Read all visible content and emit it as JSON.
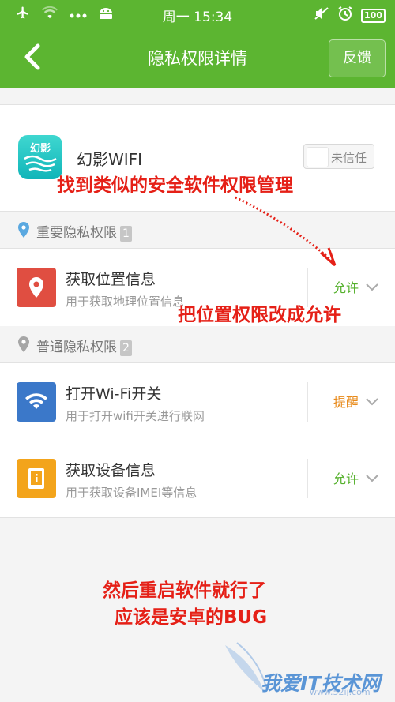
{
  "statusbar": {
    "time": "周一 15:34",
    "battery": "100"
  },
  "nav": {
    "title": "隐私权限详情",
    "feedback": "反馈"
  },
  "app": {
    "icon_text": "幻影",
    "name": "幻影WIFI",
    "trust_label": "未信任"
  },
  "sections": [
    {
      "label": "重要隐私权限",
      "count": "1"
    },
    {
      "label": "普通隐私权限",
      "count": "2"
    }
  ],
  "permissions": [
    {
      "title": "获取位置信息",
      "desc": "用于获取地理位置信息",
      "status": "允许",
      "status_color": "#54b02b",
      "icon_color": "#e04e41",
      "icon": "location-pin-icon"
    },
    {
      "title": "打开Wi-Fi开关",
      "desc": "用于打开wifi开关进行联网",
      "status": "提醒",
      "status_color": "#e88a1a",
      "icon_color": "#3b78c9",
      "icon": "wifi-icon"
    },
    {
      "title": "获取设备信息",
      "desc": "用于获取设备IMEI等信息",
      "status": "允许",
      "status_color": "#54b02b",
      "icon_color": "#f3a41b",
      "icon": "device-info-icon"
    }
  ],
  "annotations": {
    "top": "找到类似的安全软件权限管理",
    "middle": "把位置权限改成允许",
    "bottom_line1": "然后重启软件就行了",
    "bottom_line2": "应该是安卓的BUG"
  },
  "watermark": {
    "text": "我爱IT技术网",
    "sub": "www.52ij.com"
  },
  "colors": {
    "brand_green": "#5cb531",
    "annotation_red": "#e52017"
  }
}
